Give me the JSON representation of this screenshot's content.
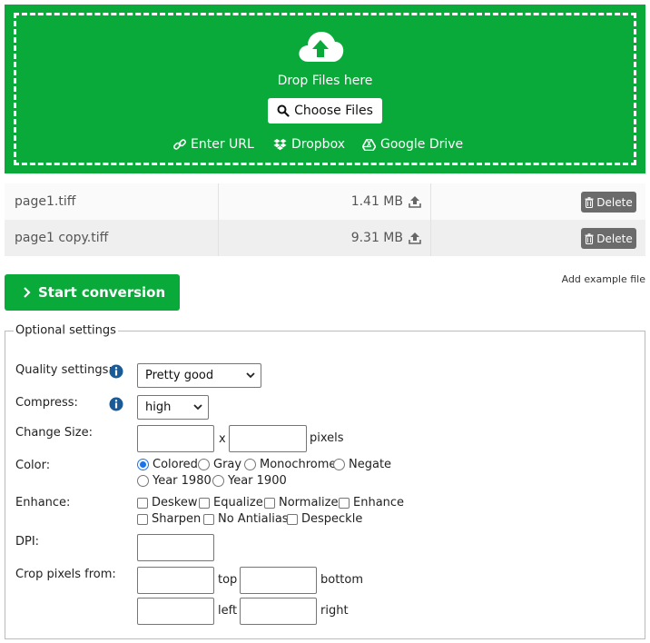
{
  "colors": {
    "brand_green": "#0aaa3a",
    "delete_gray": "#6b6b6b",
    "info_blue": "#1a5a96"
  },
  "dropzone": {
    "drop_text": "Drop Files here",
    "choose_label": "Choose Files",
    "sources": [
      {
        "label": "Enter URL",
        "icon": "link-icon"
      },
      {
        "label": "Dropbox",
        "icon": "dropbox-icon"
      },
      {
        "label": "Google Drive",
        "icon": "google-drive-icon"
      }
    ]
  },
  "files": [
    {
      "name": "page1.tiff",
      "size": "1.41 MB",
      "delete_label": "Delete"
    },
    {
      "name": "page1 copy.tiff",
      "size": "9.31 MB",
      "delete_label": "Delete"
    }
  ],
  "actions": {
    "start_label": "Start conversion",
    "example_label": "Add example file"
  },
  "settings": {
    "legend": "Optional settings",
    "quality_label": "Quality settings:",
    "quality_value": "Pretty good",
    "compress_label": "Compress:",
    "compress_value": "high",
    "size_label": "Change Size:",
    "size_x": "x",
    "size_unit": "pixels",
    "color_label": "Color:",
    "color_options": [
      "Colored",
      "Gray",
      "Monochrome",
      "Negate",
      "Year 1980",
      "Year 1900"
    ],
    "color_selected": "Colored",
    "enhance_label": "Enhance:",
    "enhance_options": [
      "Deskew",
      "Equalize",
      "Normalize",
      "Enhance",
      "Sharpen",
      "No Antialias",
      "Despeckle"
    ],
    "dpi_label": "DPI:",
    "crop_label": "Crop pixels from:",
    "crop_top": "top",
    "crop_bottom": "bottom",
    "crop_left": "left",
    "crop_right": "right"
  }
}
